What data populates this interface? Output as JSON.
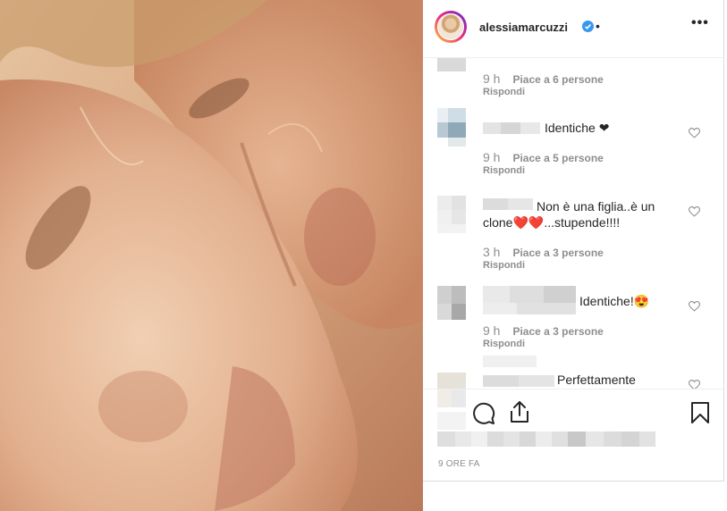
{
  "post": {
    "username": "alessiamarcuzzi",
    "time_ago": "9 ORE FA"
  },
  "comments": [
    {
      "text": "",
      "time": "9 h",
      "likes": "Piace a 6 persone",
      "reply": "Rispondi"
    },
    {
      "text": "Identiche ❤",
      "time": "9 h",
      "likes": "Piace a 5 persone",
      "reply": "Rispondi"
    },
    {
      "text_line1": "Non è una figlia..è un",
      "text_line2": "clone❤️❤️...stupende!!!!",
      "time": "3 h",
      "likes": "Piace a 3 persone",
      "reply": "Rispondi"
    },
    {
      "text": "Identiche!😍",
      "time": "9 h",
      "likes": "Piace a 3 persone",
      "reply": "Rispondi"
    },
    {
      "text": "Perfettamente"
    }
  ],
  "icons": {
    "verified": "verified-badge-icon",
    "more": "more-options-icon",
    "comment": "comment-icon",
    "share": "share-icon",
    "save": "bookmark-icon",
    "like": "heart-icon"
  },
  "colors": {
    "verified_blue": "#3897f0",
    "secondary_text": "#8e8e8e",
    "primary_text": "#262626",
    "border": "#dbdbdb"
  }
}
